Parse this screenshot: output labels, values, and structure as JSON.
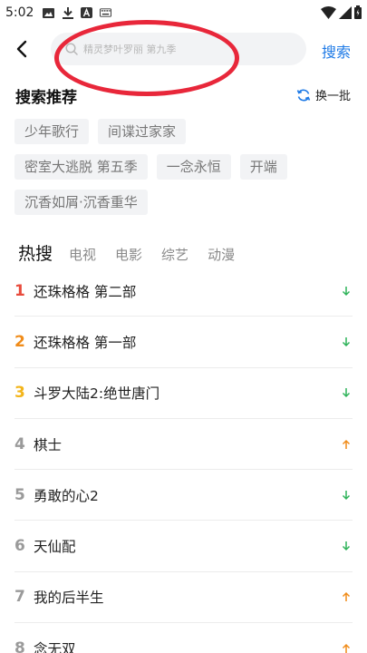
{
  "status_bar": {
    "time": "5:02"
  },
  "search": {
    "placeholder": "精灵梦叶罗丽 第九季",
    "button_label": "搜索"
  },
  "recommend": {
    "title": "搜索推荐",
    "refresh_label": "换一批",
    "tags": [
      [
        "少年歌行",
        "间谍过家家"
      ],
      [
        "密室大逃脱 第五季",
        "一念永恒",
        "开端"
      ],
      [
        "沉香如屑·沉香重华"
      ]
    ]
  },
  "hot": {
    "tabs": [
      "热搜",
      "电视",
      "电影",
      "综艺",
      "动漫"
    ],
    "items": [
      {
        "rank": "1",
        "name": "还珠格格 第二部",
        "trend": "down"
      },
      {
        "rank": "2",
        "name": "还珠格格 第一部",
        "trend": "down"
      },
      {
        "rank": "3",
        "name": "斗罗大陆2:绝世唐门",
        "trend": "down"
      },
      {
        "rank": "4",
        "name": "棋士",
        "trend": "up"
      },
      {
        "rank": "5",
        "name": "勇敢的心2",
        "trend": "down"
      },
      {
        "rank": "6",
        "name": "天仙配",
        "trend": "down"
      },
      {
        "rank": "7",
        "name": "我的后半生",
        "trend": "up"
      },
      {
        "rank": "8",
        "name": "念无双",
        "trend": "up"
      }
    ]
  },
  "colors": {
    "accent": "#1e7ae6",
    "annotation": "#e8273a",
    "trend_up": "#f08c1a",
    "trend_down": "#2fb35a"
  }
}
